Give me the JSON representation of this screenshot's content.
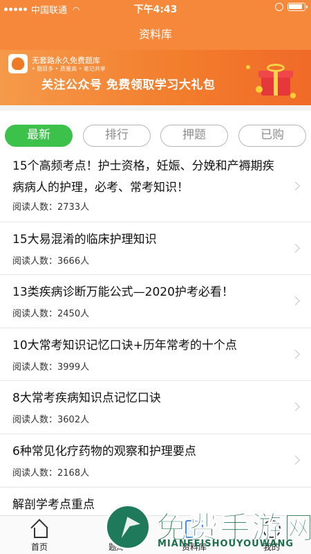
{
  "status_bar": {
    "carrier": "中国联通",
    "time": "下午4:43"
  },
  "nav": {
    "title": "资料库"
  },
  "banner": {
    "brand": "无套路永久免费题库",
    "tags": "• 题目多 • 质量高 • 笔记共享",
    "slogan": "关注公众号 免费领取学习大礼包"
  },
  "tabs": [
    {
      "label": "最新",
      "active": true
    },
    {
      "label": "排行",
      "active": false
    },
    {
      "label": "押题",
      "active": false
    },
    {
      "label": "已购",
      "active": false
    }
  ],
  "articles": [
    {
      "title": "15个高频考点！护士资格，妊娠、分娩和产褥期疾病病人的护理，必考、常考知识！",
      "reads": "阅读人数：2733人"
    },
    {
      "title": "15大易混淆的临床护理知识",
      "reads": "阅读人数：3666人"
    },
    {
      "title": "13类疾病诊断万能公式—2020护考必看！",
      "reads": "阅读人数：2450人"
    },
    {
      "title": "10大常考知识记忆口诀+历年常考的十个点",
      "reads": "阅读人数：3999人"
    },
    {
      "title": "8大常考疾病知识点记忆口诀",
      "reads": "阅读人数：3602人"
    },
    {
      "title": "6种常见化疗药物的观察和护理要点",
      "reads": "阅读人数：2168人"
    },
    {
      "title": "解剖学考点重点",
      "reads": ""
    }
  ],
  "tabbar": [
    {
      "label": "首页",
      "icon": "home-icon"
    },
    {
      "label": "题库",
      "icon": "question-bank-icon"
    },
    {
      "label": "资料库",
      "icon": "library-icon"
    },
    {
      "label": "我的",
      "icon": "profile-icon"
    }
  ],
  "watermark": {
    "cn": "免费手游网",
    "en": "MIANFEISHOUYOUWANG"
  },
  "colors": {
    "brand_orange": "#f5883a",
    "active_green": "#3cc14a"
  }
}
